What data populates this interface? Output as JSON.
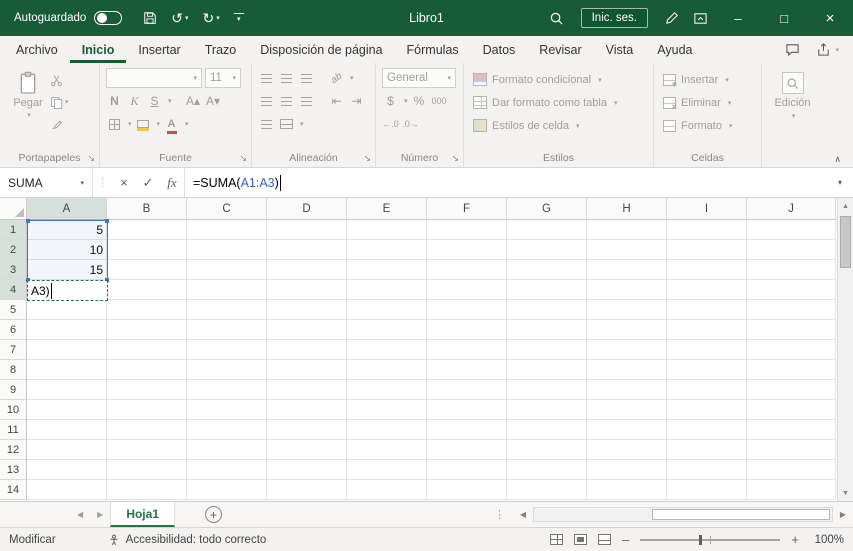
{
  "colors": {
    "title_bar": "#185C37",
    "accent": "#217346",
    "range_blue": "#4472C4",
    "formula_ref_blue": "#3B5BC4",
    "ribbon_bg": "#F3F2F1",
    "disabled_text": "#A19F9D"
  },
  "icons": {
    "dropdown": "▾",
    "undo": "↺",
    "redo": "↻",
    "minimize": "–",
    "maximize": "□",
    "close": "×",
    "cancel": "×",
    "confirm": "✓",
    "dots_handle": "⋮",
    "launcher": "↘",
    "collapse_ribbon": "∧",
    "scroll_up": "▲",
    "scroll_down": "▼",
    "scroll_left": "◀",
    "scroll_right": "▶",
    "add_sheet": "+",
    "zoom_out": "–",
    "zoom_in": "+",
    "currency": "$",
    "percent": "%",
    "comma_style": "000",
    "increase_decimal": "←.0",
    "decrease_decimal": ".0→",
    "grow_font": "A▴",
    "shrink_font": "A▾",
    "font_color": "A",
    "orientation": "ab",
    "indent_left": "⇤",
    "indent_right": "⇥"
  },
  "title_bar": {
    "autosave_label": "Autoguardado",
    "document_title": "Libro1",
    "sign_in_label": "Inic. ses."
  },
  "ribbon_tabs": {
    "active": "Inicio",
    "items": [
      {
        "label": "Archivo"
      },
      {
        "label": "Inicio"
      },
      {
        "label": "Insertar"
      },
      {
        "label": "Trazo"
      },
      {
        "label": "Disposición de página"
      },
      {
        "label": "Fórmulas"
      },
      {
        "label": "Datos"
      },
      {
        "label": "Revisar"
      },
      {
        "label": "Vista"
      },
      {
        "label": "Ayuda"
      }
    ]
  },
  "ribbon": {
    "clipboard": {
      "label": "Portapapeles",
      "paste": "Pegar"
    },
    "font": {
      "label": "Fuente",
      "size": "11",
      "bold": "N",
      "italic": "K",
      "underline": "S"
    },
    "alignment": {
      "label": "Alineación"
    },
    "number": {
      "label": "Número",
      "format": "General"
    },
    "styles": {
      "label": "Estilos",
      "items": [
        {
          "label": "Formato condicional"
        },
        {
          "label": "Dar formato como tabla"
        },
        {
          "label": "Estilos de celda"
        }
      ]
    },
    "cells": {
      "label": "Celdas",
      "items": [
        {
          "label": "Insertar"
        },
        {
          "label": "Eliminar"
        },
        {
          "label": "Formato"
        }
      ]
    },
    "editing": {
      "label": "Edición"
    }
  },
  "formula_bar": {
    "name_box": "SUMA",
    "fx": "fx",
    "formula_prefix": "=SUMA(",
    "formula_ref": "A1:A3",
    "formula_suffix": ")"
  },
  "grid": {
    "columns": [
      "A",
      "B",
      "C",
      "D",
      "E",
      "F",
      "G",
      "H",
      "I",
      "J"
    ],
    "row_count": 14,
    "cells": {
      "A1": "5",
      "A2": "10",
      "A3": "15"
    },
    "edit_cell": {
      "ref": "A4",
      "text": "A3)"
    },
    "highlight_range": "A1:A3",
    "selected_column": "A",
    "selected_rows": [
      1,
      2,
      3,
      4
    ]
  },
  "sheet_bar": {
    "tabs": [
      {
        "label": "Hoja1",
        "active": true
      }
    ]
  },
  "status_bar": {
    "mode": "Modificar",
    "accessibility": "Accesibilidad: todo correcto",
    "zoom": "100%"
  }
}
